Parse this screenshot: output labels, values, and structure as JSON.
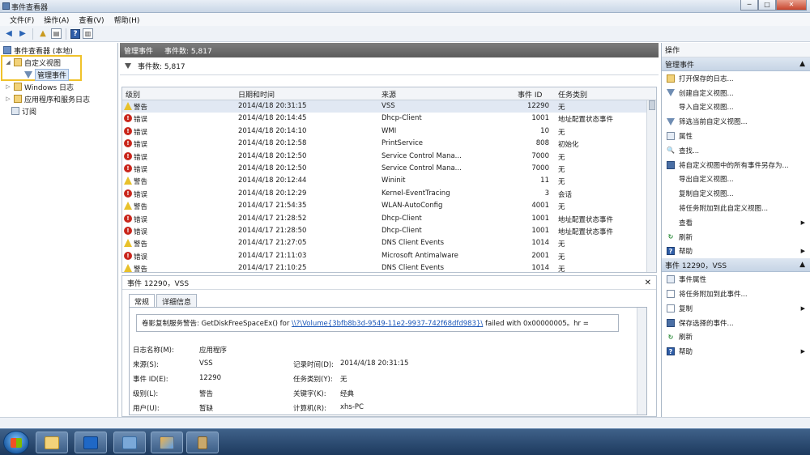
{
  "window": {
    "title": "事件查看器"
  },
  "menu": [
    "文件(F)",
    "操作(A)",
    "查看(V)",
    "帮助(H)"
  ],
  "tree": {
    "root": "事件查看器 (本地)",
    "custom_views": "自定义视图",
    "admin_events": "管理事件",
    "windows_logs": "Windows 日志",
    "app_service_logs": "应用程序和服务日志",
    "subscriptions": "订阅"
  },
  "center": {
    "header_title": "管理事件",
    "header_count": "事件数: 5,817",
    "filter_count": "事件数: 5,817",
    "columns": [
      "级别",
      "日期和时间",
      "来源",
      "事件 ID",
      "任务类别"
    ],
    "rows": [
      {
        "level": "警告",
        "type": "warn",
        "time": "2014/4/18 20:31:15",
        "source": "VSS",
        "id": "12290",
        "task": "无"
      },
      {
        "level": "错误",
        "type": "err",
        "time": "2014/4/18 20:14:45",
        "source": "Dhcp-Client",
        "id": "1001",
        "task": "地址配置状态事件"
      },
      {
        "level": "错误",
        "type": "err",
        "time": "2014/4/18 20:14:10",
        "source": "WMI",
        "id": "10",
        "task": "无"
      },
      {
        "level": "错误",
        "type": "err",
        "time": "2014/4/18 20:12:58",
        "source": "PrintService",
        "id": "808",
        "task": "初始化"
      },
      {
        "level": "错误",
        "type": "err",
        "time": "2014/4/18 20:12:50",
        "source": "Service Control Mana...",
        "id": "7000",
        "task": "无"
      },
      {
        "level": "错误",
        "type": "err",
        "time": "2014/4/18 20:12:50",
        "source": "Service Control Mana...",
        "id": "7000",
        "task": "无"
      },
      {
        "level": "警告",
        "type": "warn",
        "time": "2014/4/18 20:12:44",
        "source": "Wininit",
        "id": "11",
        "task": "无"
      },
      {
        "level": "错误",
        "type": "err",
        "time": "2014/4/18 20:12:29",
        "source": "Kernel-EventTracing",
        "id": "3",
        "task": "会话"
      },
      {
        "level": "警告",
        "type": "warn",
        "time": "2014/4/17 21:54:35",
        "source": "WLAN-AutoConfig",
        "id": "4001",
        "task": "无"
      },
      {
        "level": "错误",
        "type": "err",
        "time": "2014/4/17 21:28:52",
        "source": "Dhcp-Client",
        "id": "1001",
        "task": "地址配置状态事件"
      },
      {
        "level": "错误",
        "type": "err",
        "time": "2014/4/17 21:28:50",
        "source": "Dhcp-Client",
        "id": "1001",
        "task": "地址配置状态事件"
      },
      {
        "level": "警告",
        "type": "warn",
        "time": "2014/4/17 21:27:05",
        "source": "DNS Client Events",
        "id": "1014",
        "task": "无"
      },
      {
        "level": "错误",
        "type": "err",
        "time": "2014/4/17 21:11:03",
        "source": "Microsoft Antimalware",
        "id": "2001",
        "task": "无"
      },
      {
        "level": "警告",
        "type": "warn",
        "time": "2014/4/17 21:10:25",
        "source": "DNS Client Events",
        "id": "1014",
        "task": "无"
      }
    ]
  },
  "detail": {
    "title": "事件 12290，VSS",
    "tab_general": "常规",
    "tab_details": "详细信息",
    "desc_prefix": "卷影复制服务警告: GetDiskFreeSpaceEx() for ",
    "desc_link": "\\\\?\\Volume{3bfb8b3d-9549-11e2-9937-742f68dfd983}\\",
    "desc_suffix": " failed with 0x00000005。hr =",
    "log_name_label": "日志名称(M):",
    "log_name": "应用程序",
    "source_label": "来源(S):",
    "source": "VSS",
    "logged_label": "记录时间(D):",
    "logged": "2014/4/18 20:31:15",
    "event_id_label": "事件 ID(E):",
    "event_id": "12290",
    "task_label": "任务类别(Y):",
    "task": "无",
    "level_label": "级别(L):",
    "level": "警告",
    "keywords_label": "关键字(K):",
    "keywords": "经典",
    "user_label": "用户(U):",
    "user": "暂缺",
    "computer_label": "计算机(R):",
    "computer": "xhs-PC"
  },
  "actions": {
    "title": "操作",
    "section1": "管理事件",
    "items1": [
      {
        "label": "打开保存的日志...",
        "icon": "folder-icon"
      },
      {
        "label": "创建自定义视图...",
        "icon": "funnel-icon"
      },
      {
        "label": "导入自定义视图...",
        "icon": "blank"
      },
      {
        "label": "筛选当前自定义视图...",
        "icon": "funnel-icon"
      },
      {
        "label": "属性",
        "icon": "properties-icon"
      },
      {
        "label": "查找...",
        "icon": "find-icon"
      },
      {
        "label": "将自定义视图中的所有事件另存为...",
        "icon": "save-icon"
      },
      {
        "label": "导出自定义视图...",
        "icon": "blank"
      },
      {
        "label": "复制自定义视图...",
        "icon": "blank"
      },
      {
        "label": "将任务附加到此自定义视图...",
        "icon": "blank"
      },
      {
        "label": "查看",
        "icon": "blank",
        "arrow": true
      },
      {
        "label": "刷新",
        "icon": "refresh-icon"
      },
      {
        "label": "帮助",
        "icon": "help-icon",
        "arrow": true
      }
    ],
    "section2": "事件 12290，VSS",
    "items2": [
      {
        "label": "事件属性",
        "icon": "properties-icon"
      },
      {
        "label": "将任务附加到此事件...",
        "icon": "document-icon"
      },
      {
        "label": "复制",
        "icon": "document-icon",
        "arrow": true
      },
      {
        "label": "保存选择的事件...",
        "icon": "save-icon"
      },
      {
        "label": "刷新",
        "icon": "refresh-icon"
      },
      {
        "label": "帮助",
        "icon": "help-icon",
        "arrow": true
      }
    ]
  }
}
